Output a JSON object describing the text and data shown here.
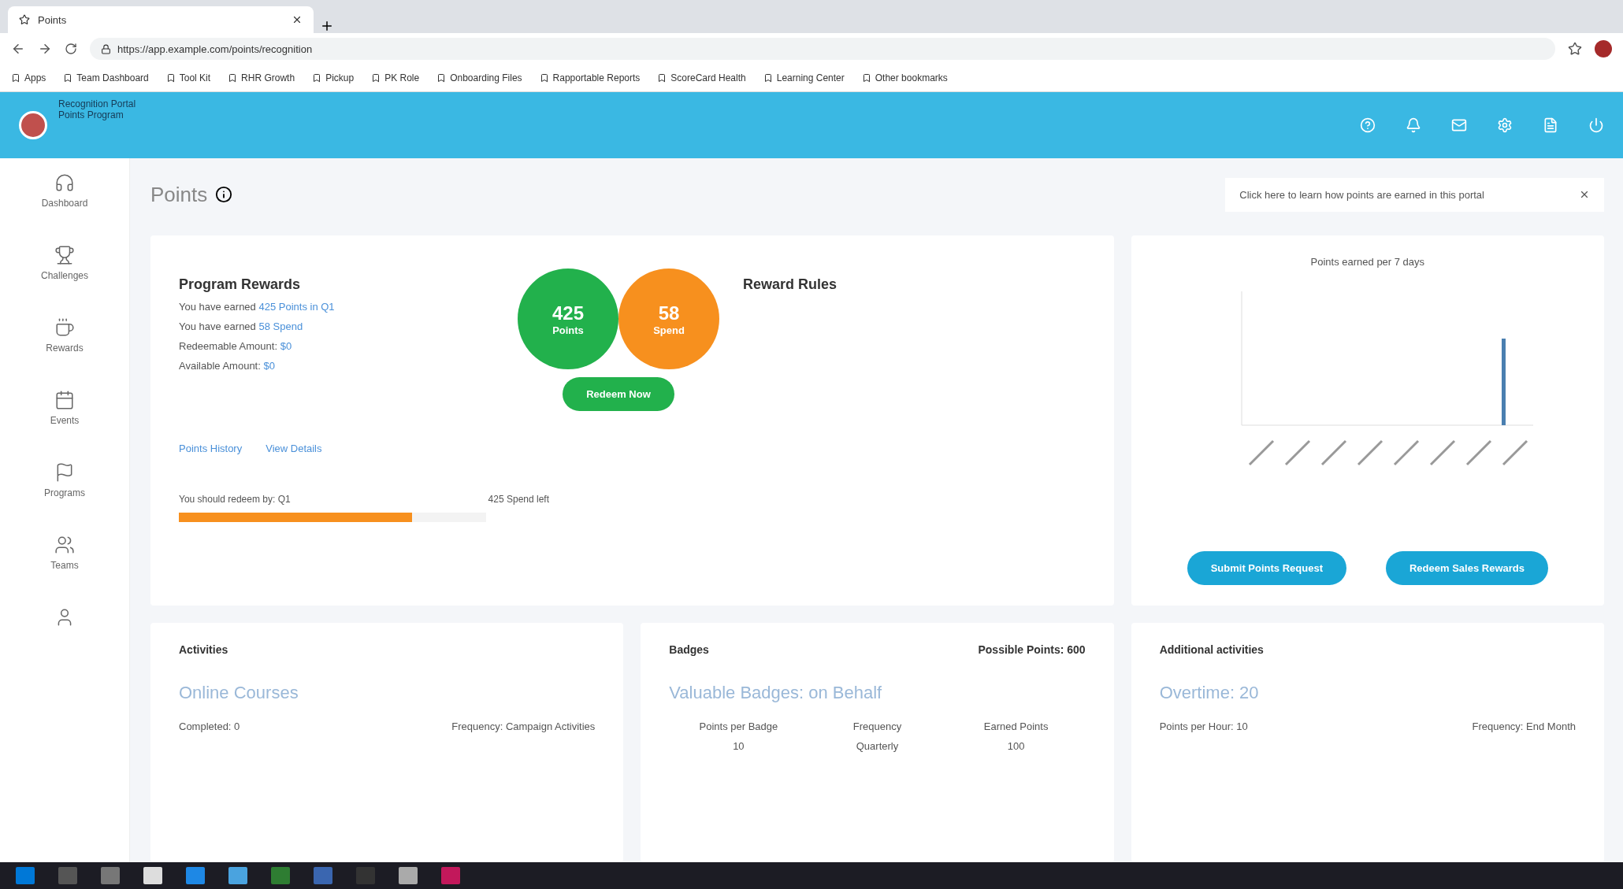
{
  "browser": {
    "tab_title": "Points",
    "url": "https://app.example.com/points/recognition",
    "bookmarks": [
      "Apps",
      "Team Dashboard",
      "Tool Kit",
      "RHR Growth",
      "Pickup",
      "PK Role",
      "Onboarding Files",
      "Rapportable Reports",
      "ScoreCard Health",
      "Learning Center",
      "Other bookmarks"
    ]
  },
  "header": {
    "title": "Recognition Portal",
    "subtitle": "Points Program"
  },
  "sidebar": {
    "items": [
      {
        "label": "Dashboard"
      },
      {
        "label": "Challenges"
      },
      {
        "label": "Rewards"
      },
      {
        "label": "Events"
      },
      {
        "label": "Programs"
      },
      {
        "label": "Teams"
      }
    ]
  },
  "page": {
    "title": "Points",
    "notice": "Click here to learn how points are earned in this portal"
  },
  "program_rewards": {
    "title": "Program Rewards",
    "lines": [
      {
        "text": "You have earned",
        "link": "425 Points in Q1"
      },
      {
        "text": "You have earned",
        "link": "58 Spend"
      },
      {
        "text": "Redeemable Amount:",
        "link": "$0"
      },
      {
        "text": "Available Amount:",
        "link": "$0"
      }
    ],
    "circles": [
      {
        "value": "425",
        "label": "Points",
        "color": "#22b14c"
      },
      {
        "value": "58",
        "label": "Spend",
        "color": "#f7901e"
      }
    ],
    "redeem_button": "Redeem Now",
    "links": [
      "Points History",
      "View Details"
    ],
    "progress": {
      "label": "You should redeem by: Q1",
      "reading": "425 Spend left",
      "level": 0.76
    },
    "rules_title": "Reward Rules"
  },
  "chart_card": {
    "title": "Points earned per 7 days",
    "buttons": [
      "Submit Points Request",
      "Redeem Sales Rewards"
    ]
  },
  "activities": {
    "title": "Activities",
    "subtitle": "Online Courses",
    "fields": [
      "Completed: 0",
      "Frequency: Campaign Activities"
    ]
  },
  "badges": {
    "title": "Badges",
    "possible": "Possible Points: 600",
    "subtitle": "Valuable Badges: on Behalf",
    "columns": [
      "Points per Badge",
      "Frequency",
      "Earned Points"
    ],
    "row": [
      "10",
      "Quarterly",
      "100"
    ]
  },
  "additional": {
    "title": "Additional activities",
    "subtitle": "Overtime: 20",
    "fields": [
      "Points per Hour: 10",
      "Frequency: End Month"
    ]
  }
}
